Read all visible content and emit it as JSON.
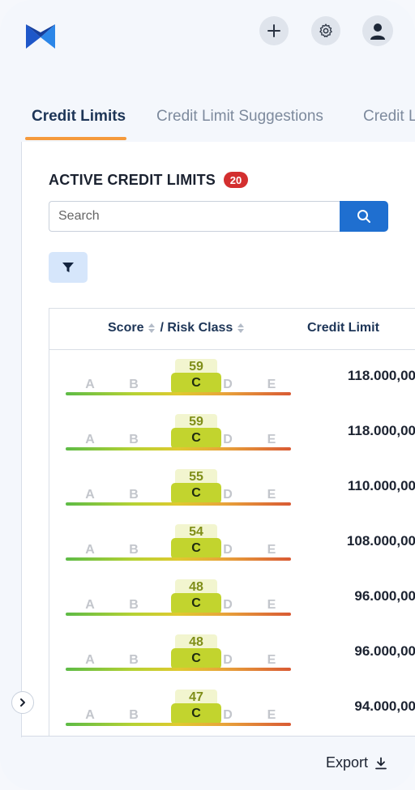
{
  "header": {
    "logo_icon": "app-logo",
    "actions": [
      {
        "icon": "plus-icon"
      },
      {
        "icon": "gear-icon"
      },
      {
        "icon": "user-avatar-icon"
      }
    ]
  },
  "tabs": [
    {
      "label": "Credit Limits",
      "active": true
    },
    {
      "label": "Credit Limit Suggestions",
      "active": false
    },
    {
      "label": "Credit Li",
      "active": false
    }
  ],
  "section": {
    "title": "ACTIVE CREDIT LIMITS",
    "count": "20"
  },
  "search": {
    "placeholder": "Search",
    "button_icon": "search-icon"
  },
  "filter": {
    "icon": "filter-icon"
  },
  "table": {
    "columns": {
      "score_label": "Score",
      "risk_class_label": "/ Risk Class",
      "credit_limit_label": "Credit Limit"
    },
    "risk_letters": [
      "A",
      "B",
      "C",
      "D",
      "E"
    ],
    "rows": [
      {
        "score": "59",
        "risk_class": "C",
        "credit_limit": "118.000,00"
      },
      {
        "score": "59",
        "risk_class": "C",
        "credit_limit": "118.000,00"
      },
      {
        "score": "55",
        "risk_class": "C",
        "credit_limit": "110.000,00"
      },
      {
        "score": "54",
        "risk_class": "C",
        "credit_limit": "108.000,00"
      },
      {
        "score": "48",
        "risk_class": "C",
        "credit_limit": "96.000,00"
      },
      {
        "score": "48",
        "risk_class": "C",
        "credit_limit": "96.000,00"
      },
      {
        "score": "47",
        "risk_class": "C",
        "credit_limit": "94.000,00"
      }
    ]
  },
  "footer": {
    "export_label": "Export",
    "export_icon": "download-icon"
  },
  "colors": {
    "accent": "#1f6fd0",
    "tab_underline": "#f59a3c",
    "badge": "#d32f2f",
    "risk_c": "#c2d42e"
  }
}
